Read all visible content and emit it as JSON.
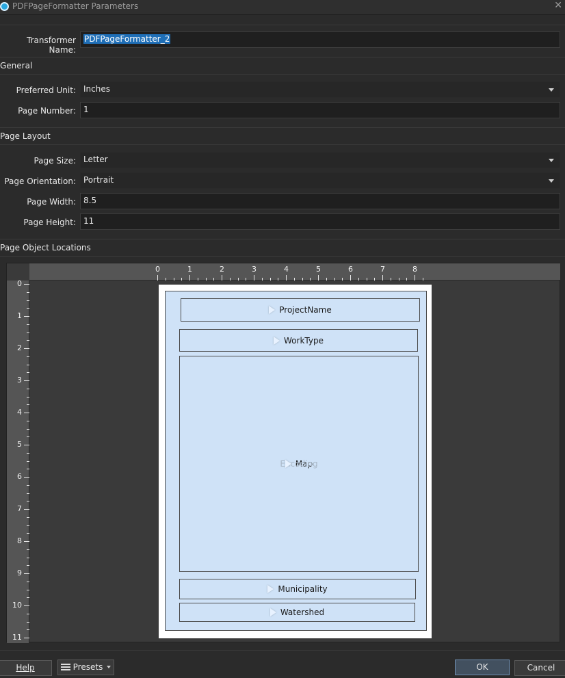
{
  "window": {
    "title": "PDFPageFormatter Parameters",
    "close_glyph": "✕"
  },
  "transformer": {
    "label": "Transformer Name:",
    "value": "PDFPageFormatter_2"
  },
  "general": {
    "header": "General",
    "preferred_unit_label": "Preferred Unit:",
    "preferred_unit_value": "Inches",
    "page_number_label": "Page Number:",
    "page_number_value": "1"
  },
  "page_layout": {
    "header": "Page Layout",
    "page_size_label": "Page Size:",
    "page_size_value": "Letter",
    "orientation_label": "Page Orientation:",
    "orientation_value": "Portrait",
    "width_label": "Page Width:",
    "width_value": "8.5",
    "height_label": "Page Height:",
    "height_value": "11"
  },
  "locations": {
    "header": "Page Object Locations",
    "ruler_x": [
      "0",
      "1",
      "2",
      "3",
      "4",
      "5",
      "6",
      "7",
      "8"
    ],
    "ruler_y": [
      "0",
      "1",
      "2",
      "3",
      "4",
      "5",
      "6",
      "7",
      "8",
      "9",
      "10",
      "11"
    ],
    "objects": {
      "project_name": "ProjectName",
      "work_type": "WorkType",
      "map": "Map",
      "map_ghost": "Encoding",
      "municipality": "Municipality",
      "watershed": "Watershed"
    }
  },
  "footer": {
    "help": "Help",
    "presets": "Presets",
    "ok": "OK",
    "cancel": "Cancel"
  },
  "colors": {
    "accent": "#1f6fb7",
    "page_object_fill": "#cfe2f7",
    "background": "#2b2b2b"
  }
}
